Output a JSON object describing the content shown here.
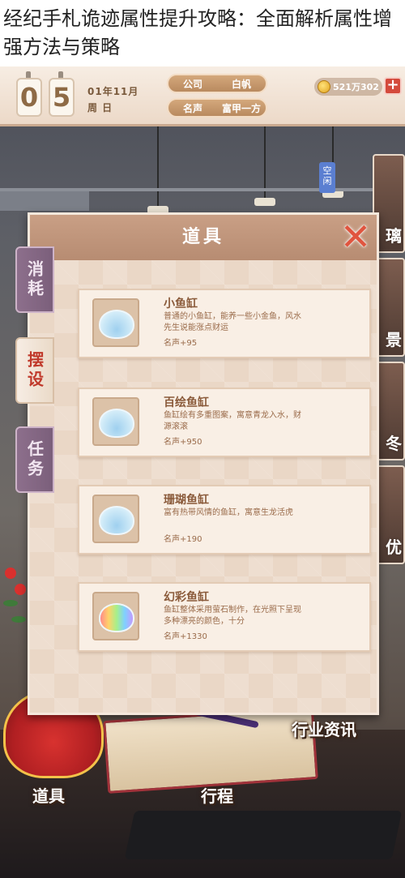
{
  "article": {
    "title": "经纪手札诡迹属性提升攻略：全面解析属性增强方法与策略"
  },
  "hud": {
    "date_digits": [
      "0",
      "5"
    ],
    "date_line1": "01年11月",
    "date_line2": "周 日",
    "company_label": "公司",
    "company_value": "白帆",
    "fame_label": "名声",
    "fame_value": "富甲一方",
    "money": "521万302",
    "plus": "+"
  },
  "side": {
    "idle_tag": "空闲",
    "portraits": [
      "璃",
      "景",
      "冬",
      "优"
    ]
  },
  "dialog": {
    "title": "道具",
    "close": "✕",
    "tabs": [
      {
        "label": "消耗",
        "active": false
      },
      {
        "label": "摆设",
        "active": true
      },
      {
        "label": "任务",
        "active": false
      }
    ],
    "items": [
      {
        "name": "小鱼缸",
        "desc": "普通的小鱼缸，能养一些小金鱼，风水先生说能涨点财运",
        "stat": "名声+95",
        "icon": "fishbowl-plain-icon"
      },
      {
        "name": "百绘鱼缸",
        "desc": "鱼缸绘有多重图案，寓意青龙入水，财源滚滚",
        "stat": "名声+950",
        "icon": "fishbowl-painted-icon"
      },
      {
        "name": "珊瑚鱼缸",
        "desc": "富有热带风情的鱼缸，寓意生龙活虎",
        "stat": "名声+190",
        "icon": "fishbowl-coral-icon"
      },
      {
        "name": "幻彩鱼缸",
        "desc": "鱼缸整体采用萤石制作，在光照下呈现多种漂亮的颜色，十分",
        "stat": "名声+1330",
        "icon": "fishbowl-rainbow-icon"
      }
    ]
  },
  "bottom": {
    "news": "行业资讯",
    "props": "道具",
    "schedule": "行程"
  },
  "colors": {
    "accent_red": "#e0553f",
    "header_brown": "#c99f85",
    "card_bg": "#f9efe5",
    "text_brown": "#8a5a3a"
  }
}
